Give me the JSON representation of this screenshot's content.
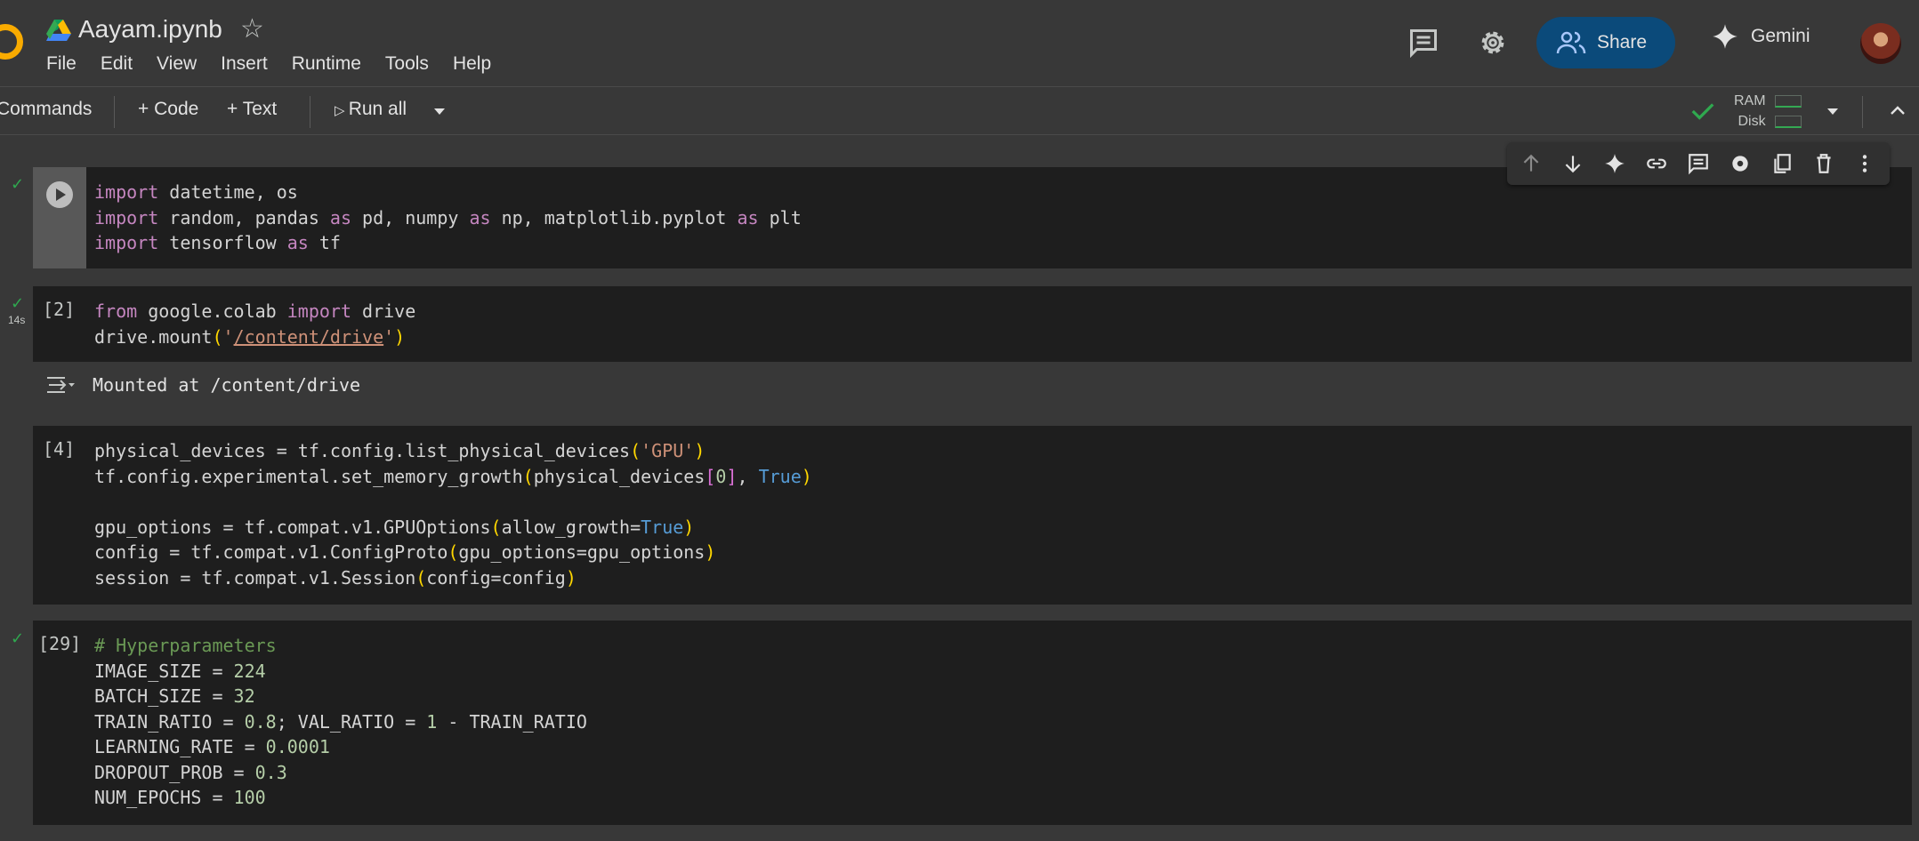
{
  "header": {
    "title": "Aayam.ipynb",
    "menu": [
      "File",
      "Edit",
      "View",
      "Insert",
      "Runtime",
      "Tools",
      "Help"
    ],
    "share_label": "Share",
    "gemini_label": "Gemini"
  },
  "toolbar": {
    "commands_label": "Commands",
    "code_label": "Code",
    "text_label": "Text",
    "run_all_label": "Run all",
    "ram_label": "RAM",
    "disk_label": "Disk"
  },
  "cells": [
    {
      "exec": "",
      "lines": [
        "import datetime, os",
        "import random, pandas as pd, numpy as np, matplotlib.pyplot as plt",
        "import tensorflow as tf"
      ]
    },
    {
      "exec": "[2]",
      "duration": "14s",
      "lines": [
        "from google.colab import drive",
        "drive.mount('/content/drive')"
      ],
      "output": "Mounted at /content/drive"
    },
    {
      "exec": "[4]",
      "lines": [
        "physical_devices = tf.config.list_physical_devices('GPU')",
        "tf.config.experimental.set_memory_growth(physical_devices[0], True)",
        "",
        "gpu_options = tf.compat.v1.GPUOptions(allow_growth=True)",
        "config = tf.compat.v1.ConfigProto(gpu_options=gpu_options)",
        "session = tf.compat.v1.Session(config=config)"
      ]
    },
    {
      "exec": "[29]",
      "lines": [
        "# Hyperparameters",
        "IMAGE_SIZE = 224",
        "BATCH_SIZE = 32",
        "TRAIN_RATIO = 0.8; VAL_RATIO = 1 - TRAIN_RATIO",
        "LEARNING_RATE = 0.0001",
        "DROPOUT_PROB = 0.3",
        "NUM_EPOCHS = 100"
      ]
    }
  ],
  "colors": {
    "accent_check": "#2fa84f",
    "share_bg": "#0b4a7a",
    "keyword": "#c586c0",
    "string": "#ce9178",
    "number": "#b5cea8",
    "boolean": "#569cd6",
    "comment": "#6a9955"
  },
  "icons": [
    "colab-logo-icon",
    "drive-icon",
    "star-icon",
    "comment-icon",
    "gear-icon",
    "people-icon",
    "sparkle-icon",
    "avatar",
    "run-cell-icon",
    "check-icon",
    "output-icon",
    "arrow-up-icon",
    "arrow-down-icon",
    "link-icon",
    "copy-icon",
    "trash-icon",
    "more-vert-icon",
    "chevron-down-icon",
    "chevron-up-icon"
  ]
}
